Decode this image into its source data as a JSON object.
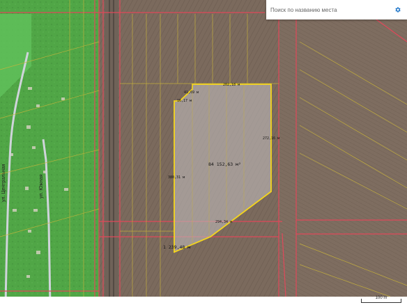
{
  "search": {
    "placeholder": "Поиск по названию места"
  },
  "settings": {
    "icon": "gear-icon",
    "color": "#1a73c8"
  },
  "roads": {
    "left_name": "ул. Центральная",
    "right_name": "ул. Южная"
  },
  "parcel": {
    "area": "84 152,63 м²",
    "perimeter": "1 239,48 м",
    "edges": {
      "top": "202,18 м",
      "small_top": "41,69 м",
      "notch": "16,17 м",
      "right": "272,16 м",
      "left": "380,31 м",
      "bottom": "294,34 м"
    },
    "outline_color": "#f5d61c"
  },
  "scale": {
    "label": "100 m"
  },
  "colors": {
    "field": "#7b6a5d",
    "green_zone": "#3fae3f",
    "cadastral_red": "#e0485a",
    "cadastral_yellow": "#c9b43a"
  }
}
